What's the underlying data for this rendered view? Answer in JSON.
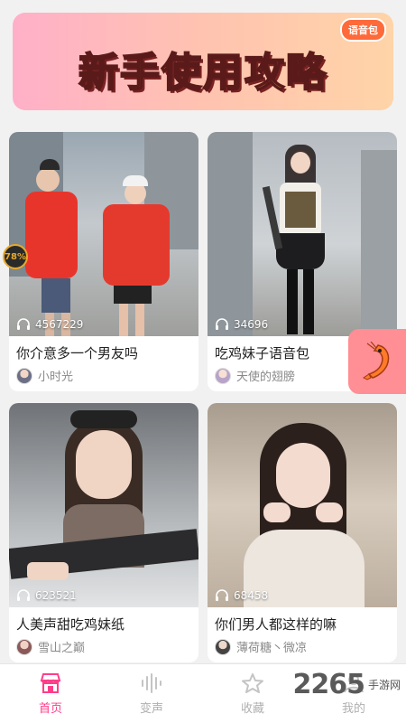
{
  "banner": {
    "title": "新手使用攻略",
    "badge": "语音包"
  },
  "cards": [
    {
      "count": "4567229",
      "title": "你介意多一个男友吗",
      "author": "小时光"
    },
    {
      "count": "34696",
      "title": "吃鸡妹子语音包",
      "author": "天使的翅膀"
    },
    {
      "count": "623521",
      "title": "人美声甜吃鸡妹纸",
      "author": "雪山之巅"
    },
    {
      "count": "68458",
      "title": "你们男人都这样的嘛",
      "author": "薄荷糖丶微凉"
    }
  ],
  "progress_badge": "78%",
  "tabs": [
    {
      "label": "首页",
      "icon": "shop-icon",
      "active": true
    },
    {
      "label": "变声",
      "icon": "waveform-icon",
      "active": false
    },
    {
      "label": "收藏",
      "icon": "star-icon",
      "active": false
    },
    {
      "label": "我的",
      "icon": "user-icon",
      "active": false
    }
  ],
  "float_button_icon": "shrimp-icon",
  "watermark": {
    "number": "2265",
    "site": "手游网"
  },
  "colors": {
    "accent": "#ff3e8a",
    "inactive": "#b0b0b0",
    "float_bg": "#ff8e95"
  }
}
